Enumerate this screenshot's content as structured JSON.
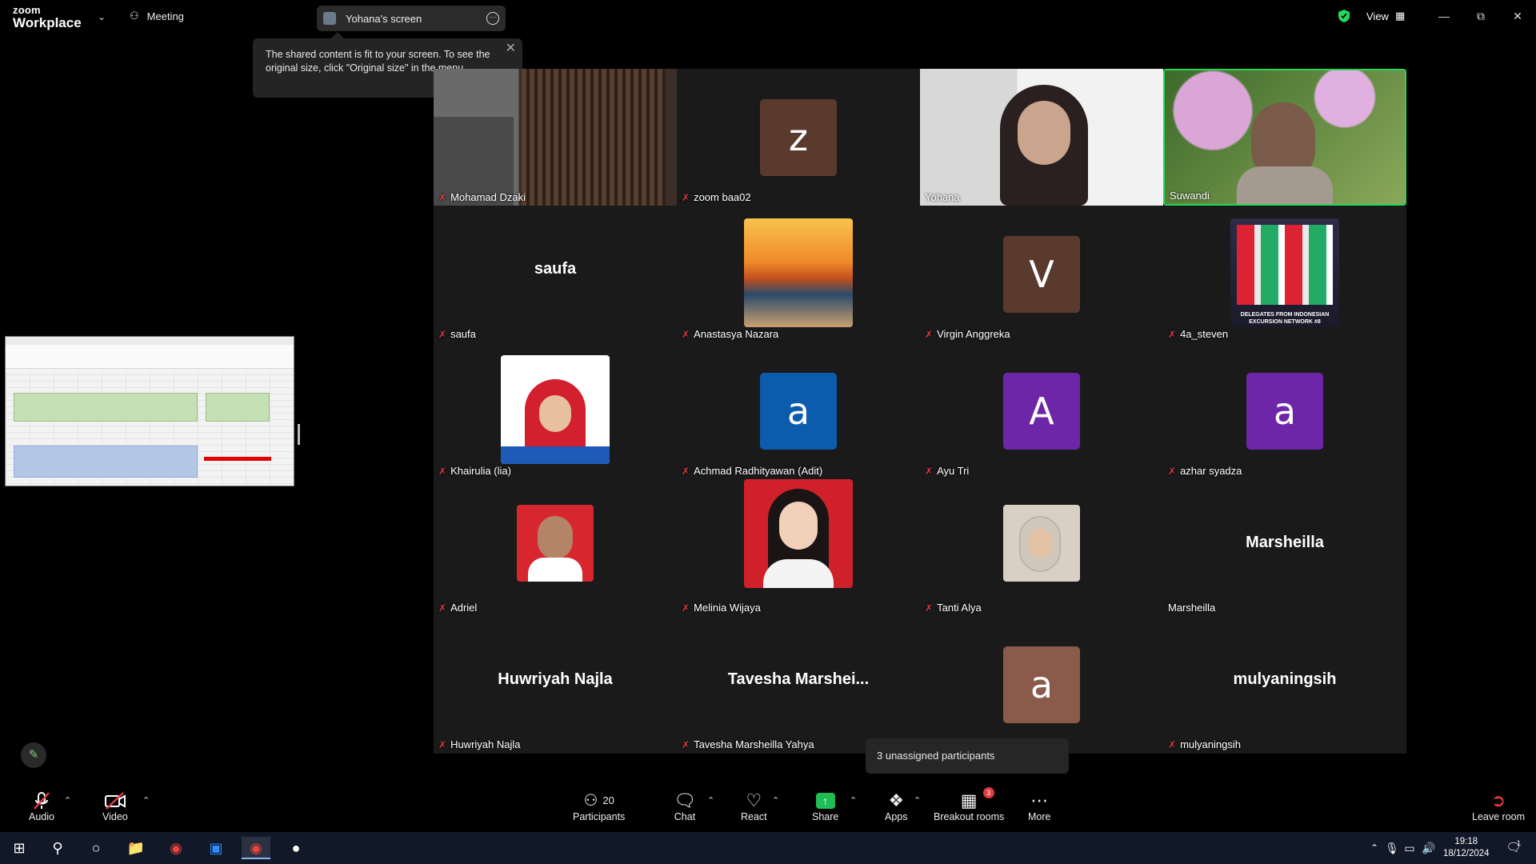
{
  "app": {
    "logo_line1": "zoom",
    "logo_line2": "Workplace"
  },
  "meeting_menu": {
    "label": "Meeting"
  },
  "screen_pill": {
    "label": "Yohana's screen"
  },
  "view": {
    "label": "View"
  },
  "tooltip": {
    "text": "The shared content is fit to your screen. To see the original size, click \"Original size\" in the menu."
  },
  "participants": [
    {
      "name": "Mohamad Dzaki",
      "kind": "video",
      "muted": true
    },
    {
      "name": "zoom baa02",
      "kind": "letter",
      "letter": "z",
      "color": "#5b3a2e",
      "muted": true
    },
    {
      "name": "Yohana",
      "kind": "video",
      "muted": false
    },
    {
      "name": "Suwandi",
      "kind": "video",
      "muted": false,
      "active": true
    },
    {
      "name": "saufa",
      "kind": "text",
      "display": "saufa",
      "muted": true
    },
    {
      "name": "Anastasya Nazara",
      "kind": "photo",
      "muted": true
    },
    {
      "name": "Virgin Anggreka",
      "kind": "letter",
      "letter": "V",
      "color": "#5b3a2e",
      "muted": true
    },
    {
      "name": "4a_steven",
      "kind": "photo",
      "muted": true
    },
    {
      "name": "Khairulia (lia)",
      "kind": "photo",
      "muted": true
    },
    {
      "name": "Achmad Radhityawan (Adit)",
      "kind": "letter",
      "letter": "a",
      "color": "#0b5cad",
      "muted": true
    },
    {
      "name": "Ayu Tri",
      "kind": "letter",
      "letter": "A",
      "color": "#6d26a8",
      "muted": true
    },
    {
      "name": "azhar syadza",
      "kind": "letter",
      "letter": "a",
      "color": "#6d26a8",
      "muted": true
    },
    {
      "name": "Adriel",
      "kind": "photo",
      "muted": true
    },
    {
      "name": "Melinia Wijaya",
      "kind": "photo",
      "muted": true
    },
    {
      "name": "Tanti Alya",
      "kind": "photo",
      "muted": true
    },
    {
      "name": "Marsheilla",
      "kind": "text",
      "display": "Marsheilla",
      "muted": false
    },
    {
      "name": "Huwriyah Najla",
      "kind": "text",
      "display": "Huwriyah Najla",
      "muted": true
    },
    {
      "name": "Tavesha Marsheilla Yahya",
      "kind": "text",
      "display": "Tavesha  Marshei...",
      "muted": true
    },
    {
      "name": "",
      "kind": "letter",
      "letter": "a",
      "color": "#8a5a4a",
      "muted": false
    },
    {
      "name": "mulyaningsih",
      "kind": "text",
      "display": "mulyaningsih",
      "muted": true
    }
  ],
  "photo_captions": {
    "steven_caption": "DELEGATES FROM INDONESIAN EXCURSION NETWORK #8"
  },
  "unassigned": {
    "label": "3 unassigned participants"
  },
  "toolbar": {
    "audio": "Audio",
    "video": "Video",
    "participants": "Participants",
    "participants_count": "20",
    "chat": "Chat",
    "react": "React",
    "share": "Share",
    "apps": "Apps",
    "breakout": "Breakout rooms",
    "breakout_badge": "3",
    "more": "More",
    "leave": "Leave room"
  },
  "taskbar": {
    "time": "19:18",
    "date": "18/12/2024",
    "notif_count": "1"
  },
  "colors": {
    "active_border": "#23d959",
    "muted_red": "#e0393e",
    "share_green": "#1fbd54"
  }
}
